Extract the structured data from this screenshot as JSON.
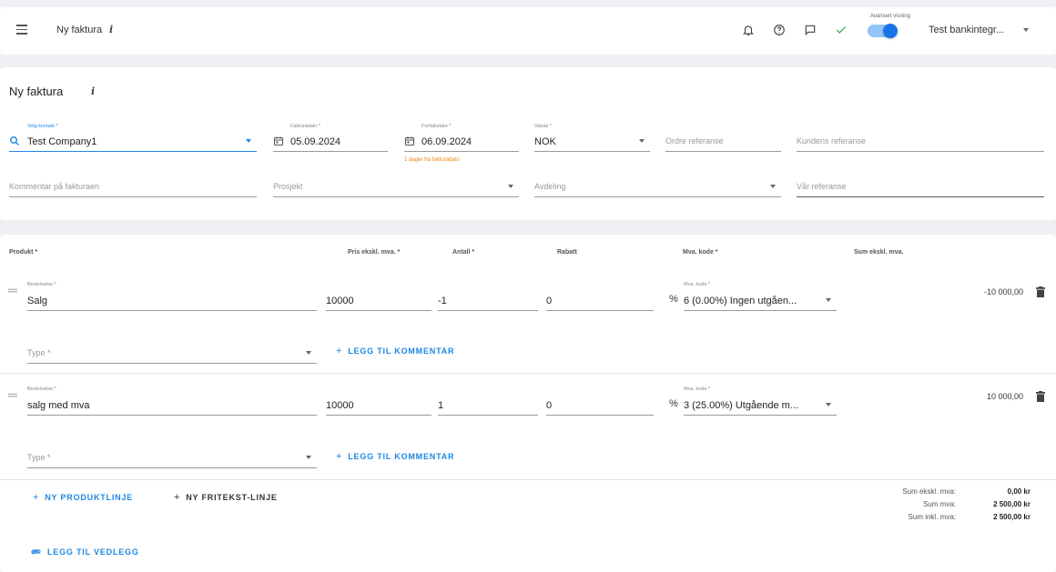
{
  "topbar": {
    "title": "Ny faktura",
    "info_icon": "i",
    "advanced_view_label": "Avansert visning",
    "advanced_view_on": true,
    "company": "Test bankintegr...",
    "icons": [
      "bell-icon",
      "help-circle-icon",
      "chat-icon",
      "check-icon"
    ]
  },
  "invoice": {
    "heading": "Ny faktura",
    "info_icon": "i",
    "contact": {
      "label": "Velg kontakt *",
      "value": "Test Company1"
    },
    "invoice_date": {
      "label": "Fakturadato *",
      "value": "05.09.2024"
    },
    "due_date": {
      "label": "Forfallsdato *",
      "value": "06.09.2024",
      "hint": "1 dager fra fakturadato"
    },
    "currency": {
      "label": "Valuta *",
      "value": "NOK"
    },
    "order_reference": {
      "placeholder": "Ordre referanse"
    },
    "customer_reference": {
      "placeholder": "Kundens referanse"
    },
    "comment": {
      "placeholder": "Kommentar på fakturaen"
    },
    "project": {
      "placeholder": "Prosjekt"
    },
    "department": {
      "placeholder": "Avdeling"
    },
    "our_reference": {
      "placeholder": "Vår referanse"
    }
  },
  "lines": {
    "headers": {
      "product": "Produkt *",
      "price": "Pris ekskl. mva. *",
      "quantity": "Antall *",
      "discount": "Rabatt",
      "vat_code": "Mva. kode *",
      "sum": "Sum ekskl. mva."
    },
    "items": [
      {
        "desc_label": "Beskrivelse *",
        "description": "Salg",
        "price": "10000",
        "quantity": "-1",
        "discount": "0",
        "pct": "%",
        "vat_label": "Mva. kode *",
        "vat_code": "6 (0.00%) Ingen utgåen...",
        "sum": "-10 000,00",
        "type_placeholder": "Type *",
        "add_comment": "LEGG TIL KOMMENTAR"
      },
      {
        "desc_label": "Beskrivelse *",
        "description": "salg med mva",
        "price": "10000",
        "quantity": "1",
        "discount": "0",
        "pct": "%",
        "vat_label": "Mva. kode *",
        "vat_code": "3 (25.00%) Utgående m...",
        "sum": "10 000,00",
        "type_placeholder": "Type *",
        "add_comment": "LEGG TIL KOMMENTAR"
      }
    ]
  },
  "actions": {
    "new_product_line": "NY PRODUKTLINJE",
    "new_freetext_line": "NY FRITEKST-LINJE",
    "add_attachment": "LEGG TIL VEDLEGG",
    "plus": "+"
  },
  "totals": {
    "sum_excl_label": "Sum ekskl. mva:",
    "sum_excl_value": "0,00 kr",
    "sum_vat_label": "Sum mva:",
    "sum_vat_value": "2 500,00 kr",
    "sum_incl_label": "Sum inkl. mva:",
    "sum_incl_value": "2 500,00 kr"
  },
  "colors": {
    "accent": "#1e88e5",
    "hint": "#f0860a",
    "success": "#2e9e44"
  }
}
